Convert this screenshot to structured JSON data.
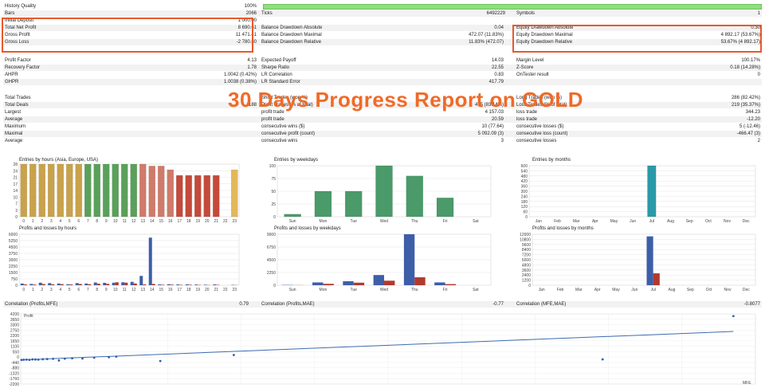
{
  "overlay_title": "30 Days Progress Report on GOLD",
  "header": {
    "history_quality_label": "History Quality",
    "history_quality_value": "100%",
    "bars_label": "Bars",
    "bars_value": "2066",
    "ticks_label": "Ticks",
    "ticks_value": "6492229",
    "symbols_label": "Symbols",
    "symbols_value": "1"
  },
  "stats_block1": [
    {
      "l": "Initial Deposit",
      "v": "1 000.00",
      "m": "",
      "mv": "",
      "r": "",
      "rv": ""
    },
    {
      "l": "Total Net Profit",
      "v": "8 690.61",
      "m": "Balance Drawdown Absolute",
      "mv": "0.04",
      "r": "Equity Drawdown Absolute",
      "rv": "0.30"
    },
    {
      "l": "Gross Profit",
      "v": "11 471.41",
      "m": "Balance Drawdown Maximal",
      "mv": "472.07 (11.83%)",
      "r": "Equity Drawdown Maximal",
      "rv": "4 892.17 (53.67%)"
    },
    {
      "l": "Gross Loss",
      "v": "-2 780.80",
      "m": "Balance Drawdown Relative",
      "mv": "11.83% (472.07)",
      "r": "Equity Drawdown Relative",
      "rv": "53.67% (4 892.17)"
    }
  ],
  "stats_block2": [
    {
      "l": "Profit Factor",
      "v": "4.13",
      "m": "Expected Payoff",
      "mv": "14.03",
      "r": "Margin Level",
      "rv": "100.17%"
    },
    {
      "l": "Recovery Factor",
      "v": "1.78",
      "m": "Sharpe Ratio",
      "mv": "22.55",
      "r": "Z-Score",
      "rv": "0.18 (14.28%)"
    },
    {
      "l": "AHPR",
      "v": "1.0042 (0.42%)",
      "m": "LR Correlation",
      "mv": "0.83",
      "r": "OnTester result",
      "rv": "0"
    },
    {
      "l": "GHPR",
      "v": "1.0038 (0.38%)",
      "m": "LR Standard Error",
      "mv": "417.79",
      "r": "",
      "rv": ""
    }
  ],
  "stats_block3": [
    {
      "l": "Total Trades",
      "v": "",
      "m": "Short Trades (won %)",
      "mv": "",
      "r": "Long Trades (won %)",
      "rv": "286 (82.42%)"
    },
    {
      "l": "Total Deals",
      "v": "1188",
      "m": "Profit Trades (% of total)",
      "mv": "475 (83.14%)",
      "r": "Loss Trades (% of total)",
      "rv": "219 (35.37%)"
    },
    {
      "l": "Largest",
      "v": "",
      "m": "profit trade",
      "mv": "4 157.03",
      "r": "loss trade",
      "rv": "344.23"
    },
    {
      "l": "Average",
      "v": "",
      "m": "profit trade",
      "mv": "20.59",
      "r": "loss trade",
      "rv": "-12.20"
    },
    {
      "l": "Maximum",
      "v": "",
      "m": "consecutive wins ($)",
      "mv": "10 (77.64)",
      "r": "consecutive losses ($)",
      "rv": "5 (-12.46)"
    },
    {
      "l": "Maximal",
      "v": "",
      "m": "consecutive profit (count)",
      "mv": "5 092.09 (3)",
      "r": "consecutive loss (count)",
      "rv": "-466.47 (3)"
    },
    {
      "l": "Average",
      "v": "",
      "m": "consecutive wins",
      "mv": "3",
      "r": "consecutive losses",
      "rv": "2"
    }
  ],
  "panels": {
    "hours_title": "Entries by hours (Asia, Europe, USA)",
    "weekdays_title": "Entries by weekdays",
    "months_title": "Entries by months",
    "pl_hours_title": "Profits and losses by hours",
    "pl_weekdays_title": "Profits and losses by weekdays",
    "pl_months_title": "Profits and losses by months"
  },
  "correlations": {
    "c1_label": "Correlation (Profits,MFE)",
    "c1_value": "0.79",
    "c2_label": "Correlation (Profits,MAE)",
    "c2_value": "-0.77",
    "c3_label": "Correlation (MFE,MAE)",
    "c3_value": "-0.8077"
  },
  "scatter": {
    "ylabel": "Profit",
    "xlabel": "MFE"
  },
  "chart_data": [
    {
      "type": "bar",
      "title": "Entries by hours (Asia, Europe, USA)",
      "categories": [
        "0",
        "1",
        "2",
        "3",
        "4",
        "5",
        "6",
        "7",
        "8",
        "9",
        "10",
        "11",
        "12",
        "13",
        "14",
        "15",
        "16",
        "17",
        "18",
        "19",
        "20",
        "21",
        "22",
        "23"
      ],
      "values": [
        28,
        28,
        28,
        28,
        28,
        28,
        28,
        28,
        28,
        28,
        28,
        28,
        28,
        28,
        27,
        27,
        25,
        22,
        22,
        22,
        22,
        22,
        0,
        25
      ],
      "colors": [
        "#c9a24a",
        "#c9a24a",
        "#c9a24a",
        "#c9a24a",
        "#c9a24a",
        "#c9a24a",
        "#c9a24a",
        "#5aa05a",
        "#5aa05a",
        "#5aa05a",
        "#5aa05a",
        "#5aa05a",
        "#5aa05a",
        "#d07a6a",
        "#d07a6a",
        "#d07a6a",
        "#d07a6a",
        "#c44a3a",
        "#c44a3a",
        "#c44a3a",
        "#c44a3a",
        "#c44a3a",
        "#c9a24a",
        "#e2b85a"
      ],
      "ylim": [
        0,
        28
      ],
      "yticks": [
        "0",
        "3",
        "7",
        "10",
        "14",
        "17",
        "21",
        "24",
        "28"
      ]
    },
    {
      "type": "bar",
      "title": "Entries by weekdays",
      "categories": [
        "Sun",
        "Mon",
        "Tue",
        "Wed",
        "Thu",
        "Fri",
        "Sat"
      ],
      "values": [
        5,
        50,
        50,
        100,
        80,
        37,
        0
      ],
      "ylim": [
        0,
        100
      ],
      "yticks": [
        "0",
        "25",
        "50",
        "75",
        "100"
      ]
    },
    {
      "type": "bar",
      "title": "Entries by months",
      "categories": [
        "Jan",
        "Feb",
        "Mar",
        "Apr",
        "May",
        "Jun",
        "Jul",
        "Aug",
        "Sep",
        "Oct",
        "Nov",
        "Dec"
      ],
      "values": [
        0,
        0,
        0,
        0,
        0,
        0,
        600,
        0,
        0,
        0,
        0,
        0
      ],
      "ylim": [
        0,
        600
      ],
      "yticks": [
        "0",
        "60",
        "120",
        "180",
        "240",
        "300",
        "360",
        "420",
        "480",
        "540",
        "600"
      ]
    },
    {
      "type": "bar",
      "title": "Profits and losses by hours",
      "categories": [
        "0",
        "1",
        "2",
        "3",
        "4",
        "5",
        "6",
        "7",
        "8",
        "9",
        "10",
        "11",
        "12",
        "13",
        "14",
        "15",
        "16",
        "17",
        "18",
        "19",
        "20",
        "21",
        "22",
        "23"
      ],
      "series": [
        {
          "values": [
            200,
            150,
            300,
            250,
            200,
            120,
            250,
            200,
            320,
            280,
            300,
            350,
            400,
            1100,
            5600,
            100,
            120,
            90,
            100,
            80,
            60,
            90,
            0,
            40
          ]
        },
        {
          "values": [
            100,
            80,
            140,
            110,
            130,
            90,
            150,
            120,
            180,
            160,
            350,
            300,
            200,
            100,
            150,
            60,
            70,
            50,
            60,
            40,
            30,
            50,
            0,
            20
          ]
        }
      ],
      "ylim": [
        0,
        6000
      ],
      "yticks": [
        "0",
        "750",
        "1500",
        "2250",
        "3000",
        "3750",
        "4500",
        "5250",
        "6000"
      ]
    },
    {
      "type": "bar",
      "title": "Profits and losses by weekdays",
      "categories": [
        "Sun",
        "Mon",
        "Tue",
        "Wed",
        "Thu",
        "Fri",
        "Sat"
      ],
      "series": [
        {
          "values": [
            50,
            500,
            700,
            1800,
            9000,
            500,
            0
          ]
        },
        {
          "values": [
            20,
            250,
            450,
            800,
            1400,
            200,
            0
          ]
        }
      ],
      "ylim": [
        0,
        9000
      ],
      "yticks": [
        "0",
        "2250",
        "4500",
        "6750",
        "9000"
      ]
    },
    {
      "type": "bar",
      "title": "Profits and losses by months",
      "categories": [
        "Jan",
        "Feb",
        "Mar",
        "Apr",
        "May",
        "Jun",
        "Jul",
        "Aug",
        "Sep",
        "Oct",
        "Nov",
        "Dec"
      ],
      "series": [
        {
          "values": [
            0,
            0,
            0,
            0,
            0,
            0,
            11500,
            0,
            0,
            0,
            0,
            0
          ]
        },
        {
          "values": [
            0,
            0,
            0,
            0,
            0,
            0,
            2800,
            0,
            0,
            0,
            0,
            0
          ]
        }
      ],
      "ylim": [
        0,
        12000
      ],
      "yticks": [
        "0",
        "1200",
        "2400",
        "3600",
        "4800",
        "6000",
        "7200",
        "8400",
        "9600",
        "10800",
        "12000"
      ]
    },
    {
      "type": "scatter",
      "xlabel": "MFE",
      "ylabel": "Profit",
      "yticks": [
        "4200",
        "3650",
        "3300",
        "2750",
        "2200",
        "1650",
        "1100",
        "550",
        "0",
        "-440",
        "-880",
        "-1320",
        "-1760",
        "-2200"
      ],
      "ylim": [
        -2200,
        4200
      ],
      "xlim": [
        0,
        5000
      ],
      "points": [
        [
          5,
          0
        ],
        [
          20,
          20
        ],
        [
          40,
          30
        ],
        [
          60,
          10
        ],
        [
          80,
          50
        ],
        [
          100,
          40
        ],
        [
          120,
          30
        ],
        [
          150,
          60
        ],
        [
          180,
          80
        ],
        [
          220,
          100
        ],
        [
          260,
          -50
        ],
        [
          300,
          120
        ],
        [
          350,
          150
        ],
        [
          420,
          130
        ],
        [
          500,
          200
        ],
        [
          600,
          250
        ],
        [
          650,
          300
        ],
        [
          950,
          -100
        ],
        [
          1450,
          450
        ],
        [
          3960,
          50
        ],
        [
          4850,
          4000
        ]
      ],
      "trendline": [
        [
          0,
          0
        ],
        [
          4850,
          2600
        ]
      ]
    }
  ]
}
